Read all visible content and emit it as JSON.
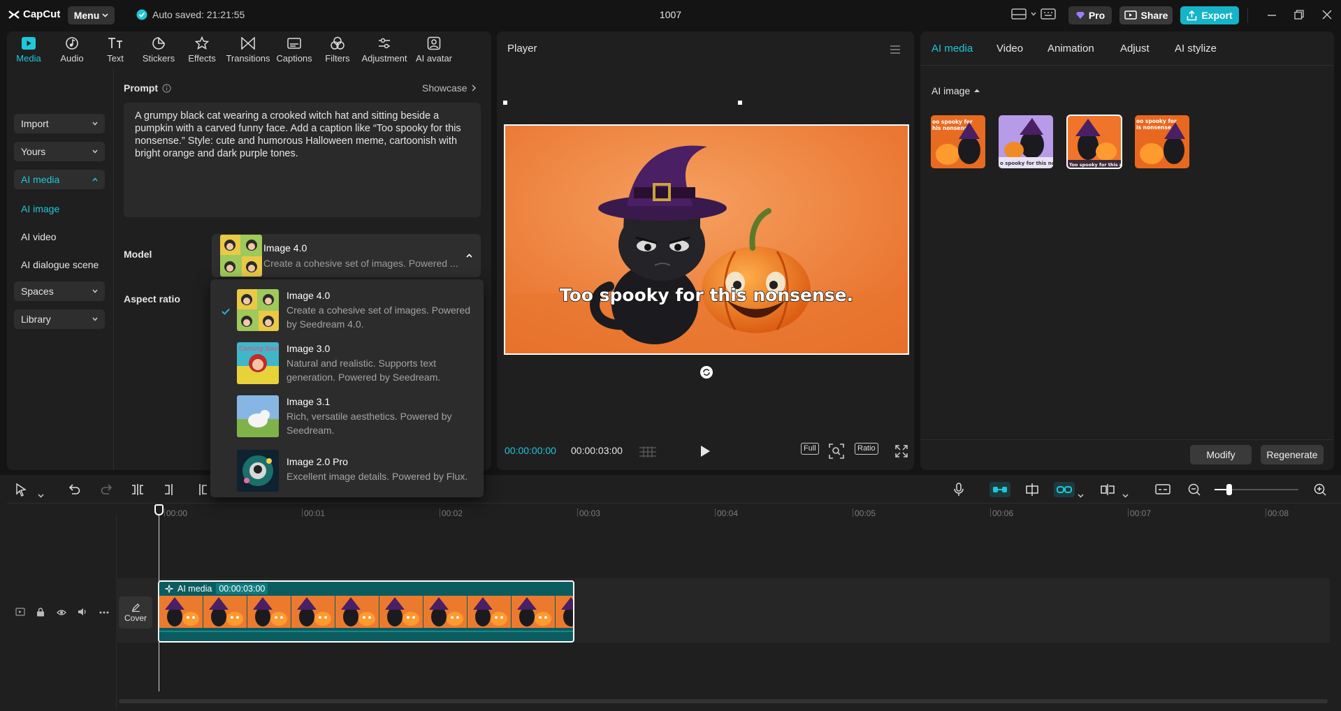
{
  "app": {
    "logo_text": "CapCut",
    "menu_label": "Menu",
    "autosave": "Auto saved: 21:21:55",
    "project_title": "1007",
    "pro_label": "Pro",
    "share_label": "Share",
    "export_label": "Export"
  },
  "toolbar": [
    {
      "label": "Media",
      "icon": "media-icon",
      "active": true
    },
    {
      "label": "Audio",
      "icon": "audio-icon"
    },
    {
      "label": "Text",
      "icon": "text-icon"
    },
    {
      "label": "Stickers",
      "icon": "stickers-icon"
    },
    {
      "label": "Effects",
      "icon": "effects-icon"
    },
    {
      "label": "Transitions",
      "icon": "transitions-icon"
    },
    {
      "label": "Captions",
      "icon": "captions-icon"
    },
    {
      "label": "Filters",
      "icon": "filters-icon"
    },
    {
      "label": "Adjustment",
      "icon": "adjustment-icon"
    },
    {
      "label": "AI avatar",
      "icon": "ai-avatar-icon"
    }
  ],
  "sidenav": {
    "import": "Import",
    "yours": "Yours",
    "ai_media": "AI media",
    "ai_image": "AI image",
    "ai_video": "AI video",
    "ai_dialogue": "AI dialogue scene",
    "spaces": "Spaces",
    "library": "Library"
  },
  "prompt": {
    "label": "Prompt",
    "showcase": "Showcase",
    "text": "A grumpy black cat wearing a crooked witch hat and sitting beside a pumpkin with a carved funny face. Add a caption like “Too spooky for this nonsense.” Style: cute and humorous Halloween meme, cartoonish with bright orange and dark purple tones."
  },
  "model": {
    "label": "Model",
    "selected_name": "Image 4.0",
    "selected_desc": "Create a cohesive set of images. Powered ...",
    "aspect_label": "Aspect ratio",
    "options": [
      {
        "name": "Image 4.0",
        "desc": "Create a cohesive set of images. Powered by Seedream 4.0.",
        "checked": true
      },
      {
        "name": "Image 3.0",
        "desc": "Natural and realistic. Supports text generation. Powered by Seedream."
      },
      {
        "name": "Image 3.1",
        "desc": "Rich, versatile aesthetics. Powered by Seedream."
      },
      {
        "name": "Image 2.0 Pro",
        "desc": "Excellent image details. Powered by Flux."
      }
    ]
  },
  "player": {
    "title": "Player",
    "caption": "Too spooky for this nonsense.",
    "current_time": "00:00:00:00",
    "total_time": "00:00:03:00",
    "full_label": "Full",
    "ratio_label": "Ratio"
  },
  "right": {
    "tabs": [
      "AI media",
      "Video",
      "Animation",
      "Adjust",
      "AI stylize"
    ],
    "section": "AI image",
    "modify": "Modify",
    "regenerate": "Regenerate"
  },
  "timeline": {
    "ruler": [
      "00:00",
      "00:01",
      "00:02",
      "00:03",
      "00:04",
      "00:05",
      "00:06",
      "00:07",
      "00:08"
    ],
    "clip_label": "AI media",
    "clip_time": "00:00:03:00",
    "cover_label": "Cover"
  },
  "colors": {
    "accent": "#1ec8d9",
    "export": "#15b4c9",
    "clip": "#0b5c5f"
  }
}
